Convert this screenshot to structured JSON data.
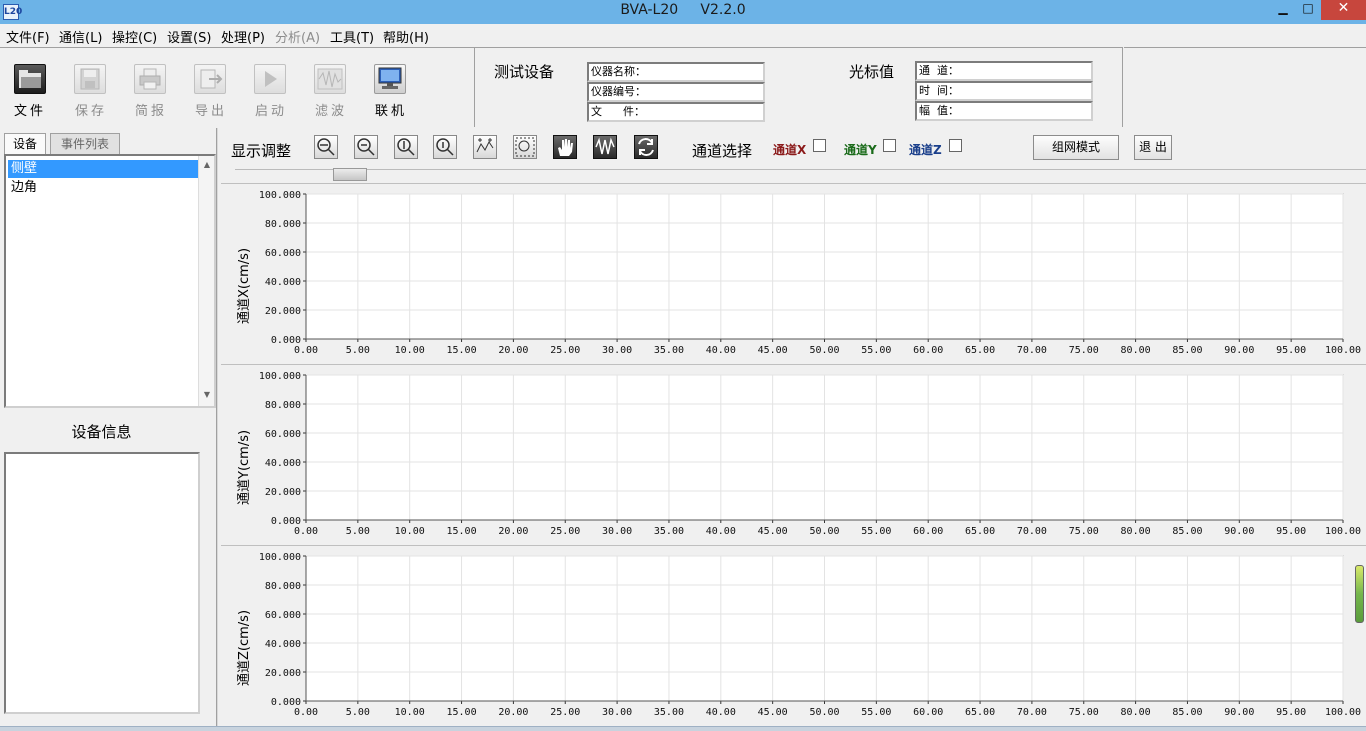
{
  "window": {
    "app_icon_text": "L20",
    "title": "BVA-L20     V2.2.0",
    "minimize": "▁",
    "maximize": "□",
    "close": "✕"
  },
  "menu": [
    {
      "label": "文件(F)",
      "enabled": true
    },
    {
      "label": "通信(L)",
      "enabled": true
    },
    {
      "label": "操控(C)",
      "enabled": true
    },
    {
      "label": "设置(S)",
      "enabled": true
    },
    {
      "label": "处理(P)",
      "enabled": true
    },
    {
      "label": "分析(A)",
      "enabled": false
    },
    {
      "label": "工具(T)",
      "enabled": true
    },
    {
      "label": "帮助(H)",
      "enabled": true
    }
  ],
  "toolbar": {
    "file": {
      "label": "文件",
      "icon": "folder-icon"
    },
    "save": {
      "label": "保存",
      "icon": "save-icon"
    },
    "report": {
      "label": "简报",
      "icon": "printer-icon"
    },
    "export": {
      "label": "导出",
      "icon": "export-icon"
    },
    "start": {
      "label": "启动",
      "icon": "play-icon"
    },
    "filter": {
      "label": "滤波",
      "icon": "waveform-icon"
    },
    "connect": {
      "label": "联机",
      "icon": "network-computer-icon"
    }
  },
  "test_device": {
    "label": "测试设备",
    "fields": [
      "仪器名称：",
      "仪器编号：",
      "文      件："
    ]
  },
  "cursor": {
    "label": "光标值",
    "fields": [
      "通  道：",
      "时  间：",
      "幅  值："
    ]
  },
  "left_panel": {
    "tabs": [
      "设备",
      "事件列表"
    ],
    "devices": [
      "侧壁",
      "边角"
    ],
    "selected_index": 0,
    "info_title": "设备信息"
  },
  "controls": {
    "display_adjust": "显示调整",
    "channel_select": "通道选择",
    "channels": [
      {
        "label": "通道X",
        "checked": false,
        "color": "#8b1a1a"
      },
      {
        "label": "通道Y",
        "checked": false,
        "color": "#1a6b1a"
      },
      {
        "label": "通道Z",
        "checked": false,
        "color": "#1a3f8b"
      }
    ],
    "network_mode": "组网模式",
    "exit": "退 出"
  },
  "chart_data": [
    {
      "type": "line",
      "ylabel": "通道X(cm/s)",
      "xlim": [
        0,
        100
      ],
      "ylim": [
        0,
        100
      ],
      "x_ticks": [
        "0.00",
        "5.00",
        "10.00",
        "15.00",
        "20.00",
        "25.00",
        "30.00",
        "35.00",
        "40.00",
        "45.00",
        "50.00",
        "55.00",
        "60.00",
        "65.00",
        "70.00",
        "75.00",
        "80.00",
        "85.00",
        "90.00",
        "95.00",
        "100.00"
      ],
      "y_ticks": [
        "100.000",
        "80.000",
        "60.000",
        "40.000",
        "20.000",
        "0.000"
      ],
      "grid": true,
      "series": []
    },
    {
      "type": "line",
      "ylabel": "通道Y(cm/s)",
      "xlim": [
        0,
        100
      ],
      "ylim": [
        0,
        100
      ],
      "x_ticks": [
        "0.00",
        "5.00",
        "10.00",
        "15.00",
        "20.00",
        "25.00",
        "30.00",
        "35.00",
        "40.00",
        "45.00",
        "50.00",
        "55.00",
        "60.00",
        "65.00",
        "70.00",
        "75.00",
        "80.00",
        "85.00",
        "90.00",
        "95.00",
        "100.00"
      ],
      "y_ticks": [
        "100.000",
        "80.000",
        "60.000",
        "40.000",
        "20.000",
        "0.000"
      ],
      "grid": true,
      "series": []
    },
    {
      "type": "line",
      "ylabel": "通道Z(cm/s)",
      "xlim": [
        0,
        100
      ],
      "ylim": [
        0,
        100
      ],
      "x_ticks": [
        "0.00",
        "5.00",
        "10.00",
        "15.00",
        "20.00",
        "25.00",
        "30.00",
        "35.00",
        "40.00",
        "45.00",
        "50.00",
        "55.00",
        "60.00",
        "65.00",
        "70.00",
        "75.00",
        "80.00",
        "85.00",
        "90.00",
        "95.00",
        "100.00"
      ],
      "y_ticks": [
        "100.000",
        "80.000",
        "60.000",
        "40.000",
        "20.000",
        "0.000"
      ],
      "grid": true,
      "series": []
    }
  ]
}
